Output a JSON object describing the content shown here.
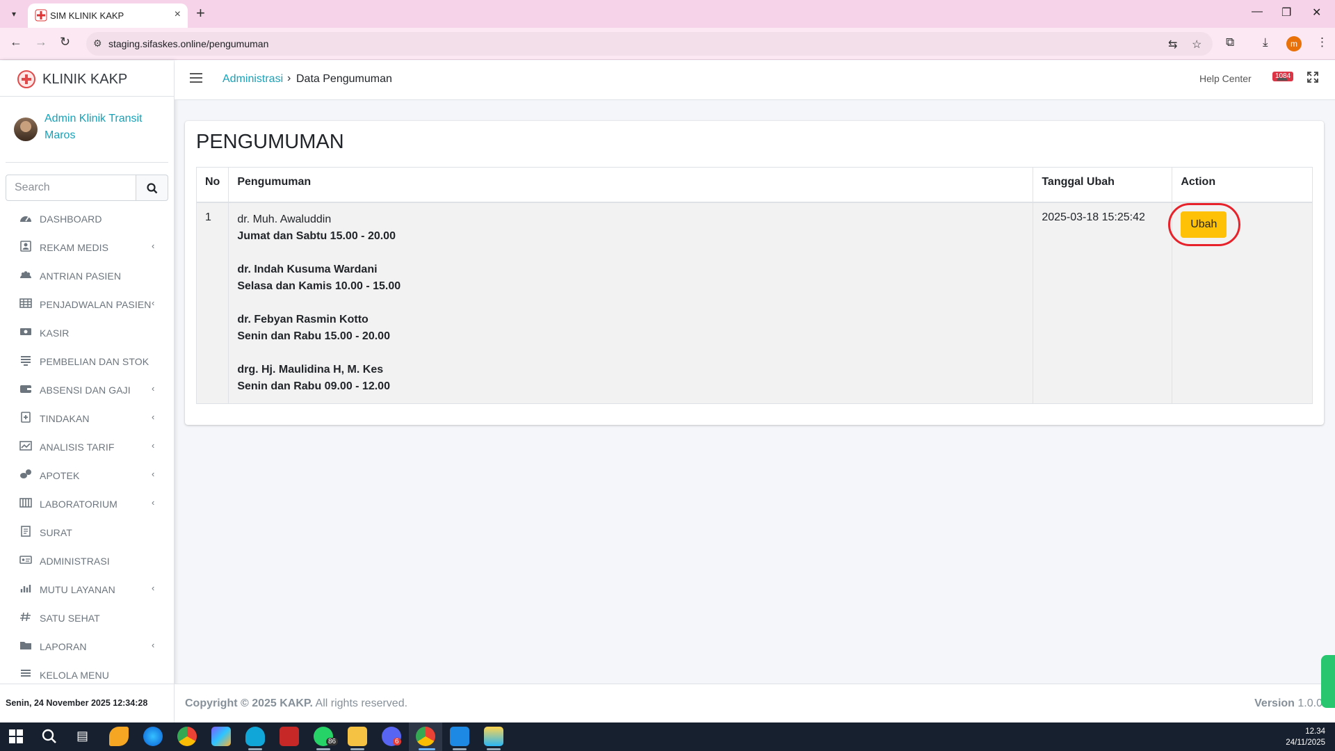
{
  "browser": {
    "tab_title": "SIM KLINIK KAKP",
    "url": "staging.sifaskes.online/pengumuman",
    "profile_initial": "m"
  },
  "sidebar": {
    "brand": "KLINIK KAKP",
    "user_name": "Admin Klinik Transit Maros",
    "search_placeholder": "Search",
    "items": [
      {
        "label": "DASHBOARD",
        "icon": "dashboard-icon",
        "submenu": false
      },
      {
        "label": "REKAM MEDIS",
        "icon": "user-card-icon",
        "submenu": true
      },
      {
        "label": "ANTRIAN PASIEN",
        "icon": "users-icon",
        "submenu": false
      },
      {
        "label": "PENJADWALAN PASIEN",
        "icon": "table-icon",
        "submenu": true
      },
      {
        "label": "KASIR",
        "icon": "cash-icon",
        "submenu": false
      },
      {
        "label": "PEMBELIAN DAN STOK",
        "icon": "list-icon",
        "submenu": false
      },
      {
        "label": "ABSENSI DAN GAJI",
        "icon": "wallet-icon",
        "submenu": true
      },
      {
        "label": "TINDAKAN",
        "icon": "medical-file-icon",
        "submenu": true
      },
      {
        "label": "ANALISIS TARIF",
        "icon": "line-chart-icon",
        "submenu": true
      },
      {
        "label": "APOTEK",
        "icon": "pills-icon",
        "submenu": true
      },
      {
        "label": "LABORATORIUM",
        "icon": "lab-icon",
        "submenu": true
      },
      {
        "label": "SURAT",
        "icon": "document-icon",
        "submenu": false
      },
      {
        "label": "ADMINISTRASI",
        "icon": "id-card-icon",
        "submenu": false
      },
      {
        "label": "MUTU LAYANAN",
        "icon": "bar-chart-icon",
        "submenu": true
      },
      {
        "label": "SATU SEHAT",
        "icon": "hash-icon",
        "submenu": false
      },
      {
        "label": "LAPORAN",
        "icon": "folder-icon",
        "submenu": true
      },
      {
        "label": "KELOLA MENU",
        "icon": "menu-list-icon",
        "submenu": false
      }
    ],
    "datetime": "Senin, 24 November 2025 12:34:28"
  },
  "navbar": {
    "breadcrumb_parent": "Administrasi",
    "breadcrumb_separator": "›",
    "breadcrumb_current": "Data Pengumuman",
    "help": "Help Center",
    "notification_count": "1084"
  },
  "content": {
    "title": "PENGUMUMAN",
    "columns": [
      "No",
      "Pengumuman",
      "Tanggal Ubah",
      "Action"
    ],
    "row": {
      "no": "1",
      "announcement": [
        {
          "text": "dr. Muh. Awaluddin",
          "bold": false
        },
        {
          "text": "Jumat dan Sabtu 15.00 - 20.00",
          "bold": true
        },
        {
          "text": "",
          "bold": false
        },
        {
          "text": "dr. Indah Kusuma Wardani",
          "bold": true
        },
        {
          "text": "Selasa dan Kamis 10.00 - 15.00",
          "bold": true
        },
        {
          "text": "",
          "bold": false
        },
        {
          "text": "dr. Febyan Rasmin Kotto",
          "bold": true
        },
        {
          "text": "Senin dan Rabu 15.00 - 20.00",
          "bold": true
        },
        {
          "text": "",
          "bold": false
        },
        {
          "text": "drg. Hj. Maulidina H, M. Kes",
          "bold": true
        },
        {
          "text": "Senin dan Rabu 09.00 - 12.00",
          "bold": true
        }
      ],
      "updated": "2025-03-18 15:25:42",
      "action_label": "Ubah"
    }
  },
  "footer": {
    "copyright_bold": "Copyright © 2025 KAKP.",
    "copyright_rest": " All rights reserved.",
    "version_label": "Version",
    "version_value": "1.0.0"
  },
  "taskbar": {
    "time": "12.34",
    "date": "24/11/2025",
    "whatsapp_badge": "86",
    "discord_badge": "6"
  },
  "colors": {
    "accent": "#17a2b8",
    "action_button": "#ffc107",
    "highlight_ring": "#e8222b",
    "browser_frame": "#f7d3e9"
  }
}
